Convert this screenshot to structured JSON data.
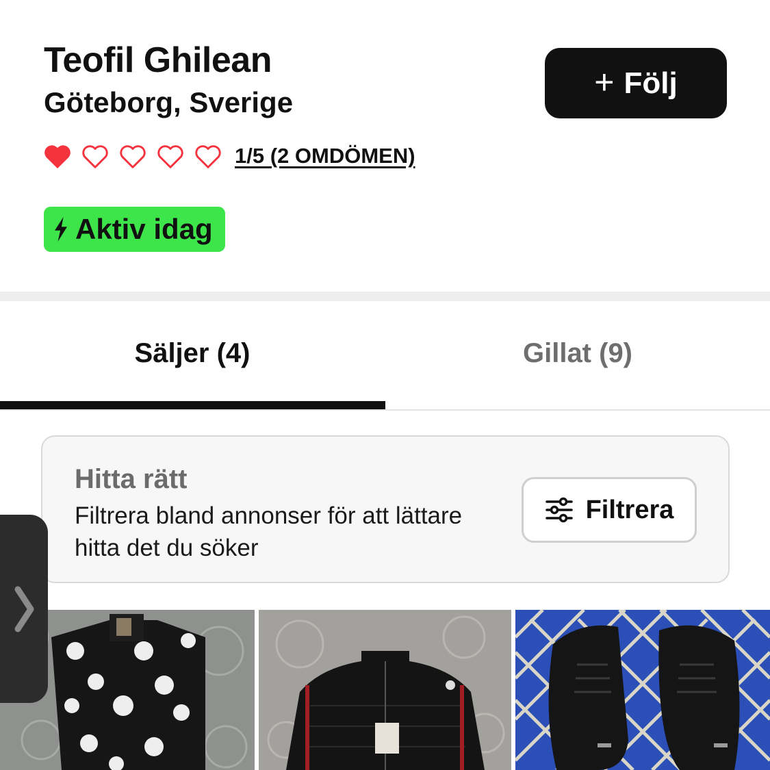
{
  "profile": {
    "name": "Teofil Ghilean",
    "location": "Göteborg, Sverige",
    "follow_label": "Följ",
    "rating": {
      "value": 1,
      "max": 5,
      "label": "1/5 (2 OMDÖMEN)"
    },
    "activity_badge": "Aktiv idag"
  },
  "tabs": [
    {
      "label": "Säljer (4)",
      "active": true
    },
    {
      "label": "Gillat (9)",
      "active": false
    }
  ],
  "filter_card": {
    "title": "Hitta rätt",
    "description": "Filtrera bland annonser för att lättare hitta det du söker",
    "button_label": "Filtrera"
  },
  "listings": [
    {
      "image": "black-tracksuit-with-white-flower-print"
    },
    {
      "image": "black-padded-jacket"
    },
    {
      "image": "black-sneakers"
    }
  ],
  "colors": {
    "accent_dark": "#111111",
    "activity_green": "#3ee54a",
    "heart_red": "#f5333f",
    "inactive_tab": "#6e6e6e"
  },
  "icons": [
    "plus-icon",
    "heart-filled-icon",
    "heart-outline-icon",
    "lightning-icon",
    "sliders-icon",
    "chevron-right-icon"
  ]
}
